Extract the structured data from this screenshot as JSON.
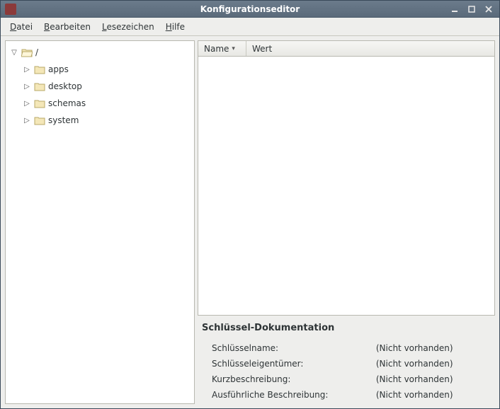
{
  "titlebar": {
    "title": "Konfigurationseditor"
  },
  "menubar": {
    "file": {
      "label": "Datei",
      "mnemonic_index": 0
    },
    "edit": {
      "label": "Bearbeiten",
      "mnemonic_index": 0
    },
    "book": {
      "label": "Lesezeichen",
      "mnemonic_index": 0
    },
    "help": {
      "label": "Hilfe",
      "mnemonic_index": 0
    }
  },
  "tree": {
    "root": {
      "label": "/",
      "expanded": true
    },
    "children": [
      {
        "label": "apps"
      },
      {
        "label": "desktop"
      },
      {
        "label": "schemas"
      },
      {
        "label": "system"
      }
    ]
  },
  "list": {
    "col_name": "Name",
    "col_value": "Wert"
  },
  "doc": {
    "heading": "Schlüssel-Dokumentation",
    "rows": [
      {
        "label": "Schlüsselname:",
        "value": "(Nicht vorhanden)"
      },
      {
        "label": "Schlüsseleigentümer:",
        "value": "(Nicht vorhanden)"
      },
      {
        "label": "Kurzbeschreibung:",
        "value": "(Nicht vorhanden)"
      },
      {
        "label": "Ausführliche Beschreibung:",
        "value": "(Nicht vorhanden)"
      }
    ]
  }
}
